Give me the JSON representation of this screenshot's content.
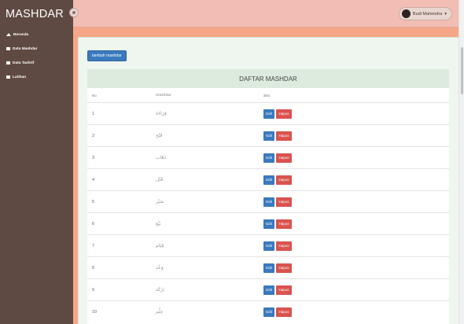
{
  "header": {
    "brand": "MASHDAR",
    "user_name": "Budi Mahendra"
  },
  "sidebar": {
    "items": [
      {
        "label": "Beranda",
        "icon": "home-icon"
      },
      {
        "label": "Data Mashdar",
        "icon": "table-icon"
      },
      {
        "label": "Data Tashrif",
        "icon": "table-icon"
      },
      {
        "label": "Latihan",
        "icon": "list-icon"
      }
    ]
  },
  "main": {
    "add_button": "tambah mashdar",
    "table": {
      "title": "DAFTAR MASHDAR",
      "columns": [
        "No",
        "mashdar",
        "aksi"
      ],
      "rows": [
        {
          "no": "1",
          "mashdar": "قِرَاءَة",
          "edit": "Edit",
          "hapus": "Hapus"
        },
        {
          "no": "2",
          "mashdar": "فَتْح",
          "edit": "Edit",
          "hapus": "Hapus"
        },
        {
          "no": "3",
          "mashdar": "ذَهَاب",
          "edit": "Edit",
          "hapus": "Hapus"
        },
        {
          "no": "4",
          "mashdar": "قَتْل",
          "edit": "Edit",
          "hapus": "Hapus"
        },
        {
          "no": "5",
          "mashdar": "صَبْر",
          "edit": "Edit",
          "hapus": "Hapus"
        },
        {
          "no": "6",
          "mashdar": "بَيْع",
          "edit": "Edit",
          "hapus": "Hapus"
        },
        {
          "no": "7",
          "mashdar": "قِيَام",
          "edit": "Edit",
          "hapus": "Hapus"
        },
        {
          "no": "8",
          "mashdar": "وَعْد",
          "edit": "Edit",
          "hapus": "Hapus"
        },
        {
          "no": "9",
          "mashdar": "بَرَكَة",
          "edit": "Edit",
          "hapus": "Hapus"
        },
        {
          "no": "10",
          "mashdar": "عِلْم",
          "edit": "Edit",
          "hapus": "Hapus"
        }
      ]
    }
  },
  "colors": {
    "sidebar": "#5e4a42",
    "topbar": "#f2bdb2",
    "accent": "#f5a787",
    "primary_button": "#3a79be",
    "danger_button": "#d9534f"
  }
}
